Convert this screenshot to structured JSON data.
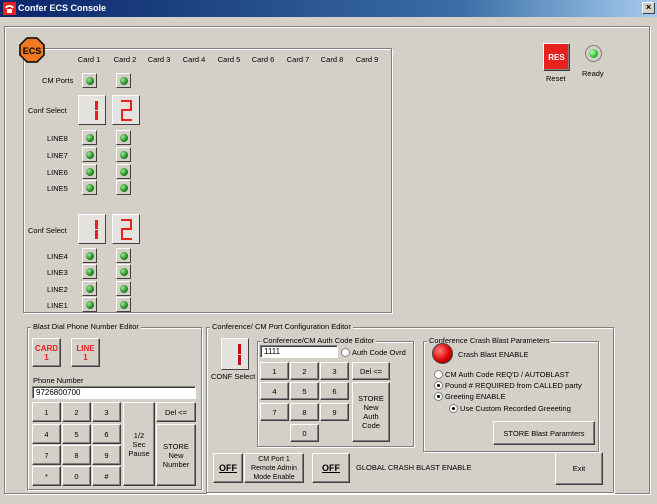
{
  "window": {
    "title": "Confer ECS Console",
    "close_glyph": "×"
  },
  "logo": {
    "text": "ECS"
  },
  "card_headers": [
    "Card 1",
    "Card 2",
    "Card 3",
    "Card 4",
    "Card 5",
    "Card 6",
    "Card 7",
    "Card 8",
    "Card 9"
  ],
  "cm_ports_label": "CM Ports",
  "conf_select_label": "Conf Select",
  "conf_select_digits": {
    "upper": [
      "1",
      "2"
    ],
    "lower": [
      "1",
      "2"
    ]
  },
  "upper_lines": [
    "LINE8",
    "LINE7",
    "LINE6",
    "LINE5"
  ],
  "lower_lines": [
    "LINE4",
    "LINE3",
    "LINE2",
    "LINE1"
  ],
  "reset": {
    "icon_text": "RES",
    "label": "Reset"
  },
  "ready": {
    "label": "Ready"
  },
  "blast_dial": {
    "title": "Blast Dial Phone Number Editor",
    "card_btn": {
      "line1": "CARD",
      "line2": "1"
    },
    "line_btn": {
      "line1": "LINE",
      "line2": "1"
    },
    "phone_label": "Phone Number",
    "phone_value": "9726800700",
    "keys": [
      "1",
      "2",
      "3",
      "4",
      "5",
      "6",
      "7",
      "8",
      "9",
      "*",
      "0",
      "#"
    ],
    "pause_label": "1/2\nSec\nPause",
    "del_label": "Del <=",
    "store_label": "STORE\nNew\nNumber"
  },
  "conf_cm": {
    "title": "Conference/ CM Port Configuration Editor",
    "conf_select_digit": "1",
    "conf_select_label": "CONF Select",
    "auth_title": "Conference/CM Auth Code Editor",
    "auth_value": "1111",
    "auth_ovrd_label": "Auth Code Ovrd",
    "keys": [
      "1",
      "2",
      "3",
      "4",
      "5",
      "6",
      "7",
      "8",
      "9",
      "0"
    ],
    "del_label": "Del <=",
    "store_label": "STORE\nNew\nAuth\nCode"
  },
  "crash_blast": {
    "title": "Conference Crash Blast Parameters",
    "enable_label": "Crash Blast ENABLE",
    "options": [
      {
        "label": "CM Auth Code REQ'D / AUTOBLAST",
        "selected": false
      },
      {
        "label": "Pound # REQUIRED from CALLED party",
        "selected": true
      },
      {
        "label": "Greeting ENABLE",
        "selected": true
      }
    ],
    "custom_greeting_label": "Use Custom Recorded Greeeting",
    "custom_greeting_selected": true,
    "store_label": "STORE Blast Paramters"
  },
  "bottom": {
    "off_label": "OFF",
    "cm_port_label": "CM Port 1\nRemote Admin\nMode Enable",
    "global_label": "GLOBAL CRASH BLAST ENABLE",
    "exit_label": "Exit"
  },
  "colors": {
    "led_green": "#1e8a1e",
    "segment_red": "#e8201e",
    "title_blue": "#0a246a"
  }
}
